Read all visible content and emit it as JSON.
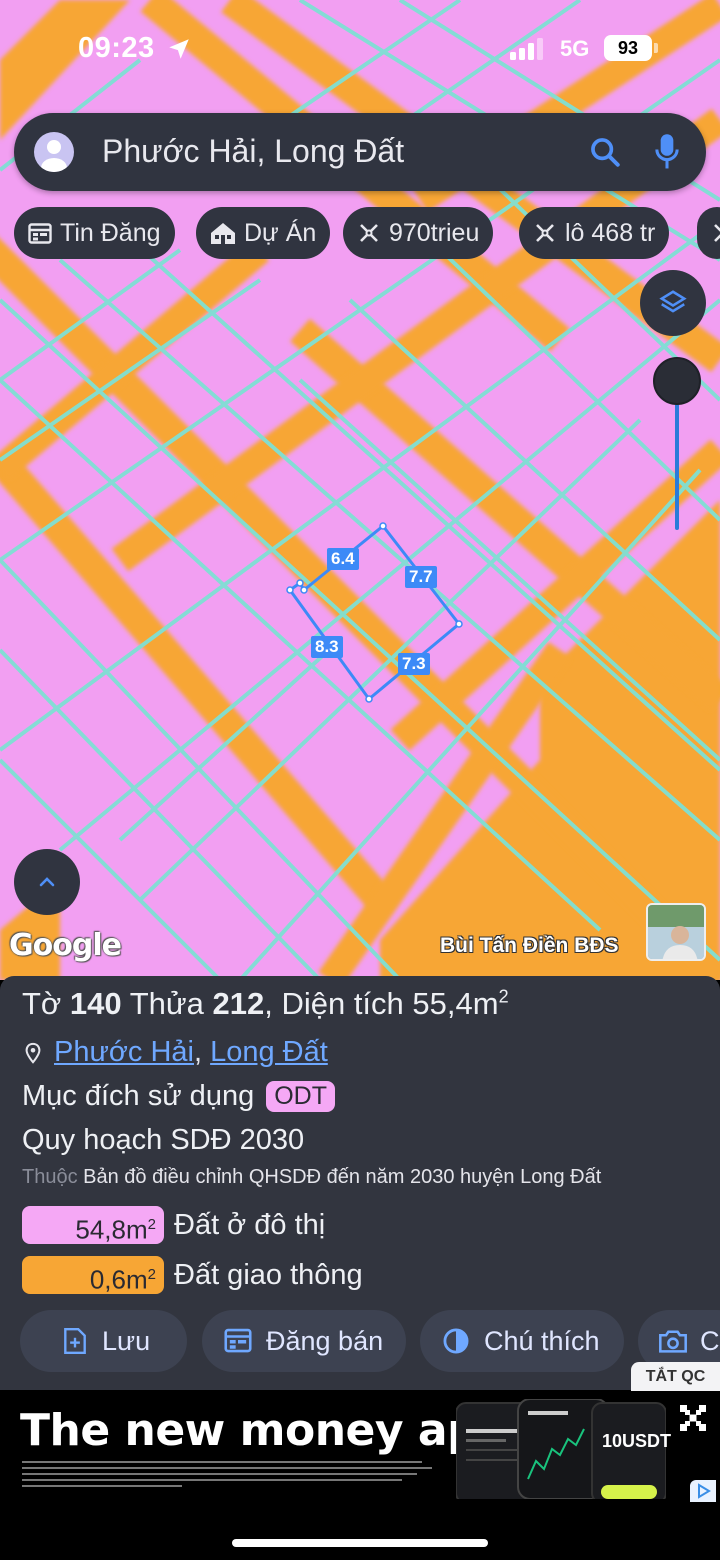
{
  "status_bar": {
    "time": "09:23",
    "network": "5G",
    "battery": "93"
  },
  "search": {
    "query": "Phước Hải, Long Đất"
  },
  "chips": [
    {
      "label": "Tin Đăng",
      "icon": "calendar-icon"
    },
    {
      "label": "Dự Án",
      "icon": "building-icon"
    },
    {
      "label": "970trieu",
      "icon": "ruler-icon"
    },
    {
      "label": "lô 468 tr",
      "icon": "ruler-icon"
    }
  ],
  "map": {
    "plot_edges": [
      "6.4",
      "7.7",
      "8.3",
      "7.3"
    ],
    "attribution": "Google",
    "watermark": "Bùi Tấn Điền BĐS",
    "colors": {
      "residential": "#f29ff2",
      "traffic": "#f7a635",
      "boundary": "#7fe0d4",
      "plot_outline": "#3d8af7"
    }
  },
  "panel": {
    "sheet_label": "Tờ",
    "sheet_number": "140",
    "parcel_label": "Thửa",
    "parcel_number": "212",
    "area_label": ", Diện tích 55,4m",
    "area_unit_sup": "2",
    "ward": "Phước Hải",
    "district": "Long Đất",
    "purpose_label": "Mục đích sử dụng",
    "purpose_code": "ODT",
    "plan_label": "Quy hoạch SDĐ 2030",
    "source_prefix": "Thuộc",
    "source_text": "Bản đồ điều chỉnh QHSDĐ đến năm 2030 huyện Long Đất",
    "land_uses": [
      {
        "area": "54,8m",
        "label": "Đất ở đô thị",
        "color": "#f5a8f5"
      },
      {
        "area": "0,6m",
        "label": "Đất giao thông",
        "color": "#f7a635"
      }
    ],
    "actions": [
      {
        "label": "Lưu",
        "icon": "save-icon"
      },
      {
        "label": "Đăng bán",
        "icon": "calendar-icon"
      },
      {
        "label": "Chú thích",
        "icon": "contrast-icon"
      },
      {
        "label": "C",
        "icon": "camera-icon"
      }
    ],
    "hide_ads": "TẮT QC"
  },
  "ad": {
    "headline": "The new money app.",
    "price_tag": "10USDT"
  }
}
